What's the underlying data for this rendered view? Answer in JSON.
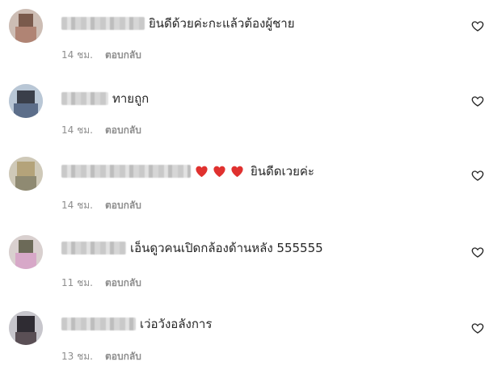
{
  "comments": [
    {
      "text": "ยินดีด้วยค่ะกะแล้วต้องผู้ชาย",
      "time": "14 ชม.",
      "reply": "ตอบกลับ",
      "hearts": 0
    },
    {
      "text": "ทายถูก",
      "time": "14 ชม.",
      "reply": "ตอบกลับ",
      "hearts": 0
    },
    {
      "text": "ยินดีดเวยค่ะ",
      "time": "14 ชม.",
      "reply": "ตอบกลับ",
      "hearts": 3
    },
    {
      "text": "เอ็นดูวคนเปิดกล้องด้านหลัง 555555",
      "time": "11 ชม.",
      "reply": "ตอบกลับ",
      "hearts": 0
    },
    {
      "text": "เว่อวังอลังการ",
      "time": "13 ชม.",
      "reply": "ตอบกลับ",
      "hearts": 0
    }
  ],
  "icons": {
    "like": "heart-outline-icon",
    "emoji": "red-heart-icon"
  },
  "colors": {
    "text": "#262626",
    "meta": "#8e8e8e",
    "heart": "#ed4956"
  }
}
